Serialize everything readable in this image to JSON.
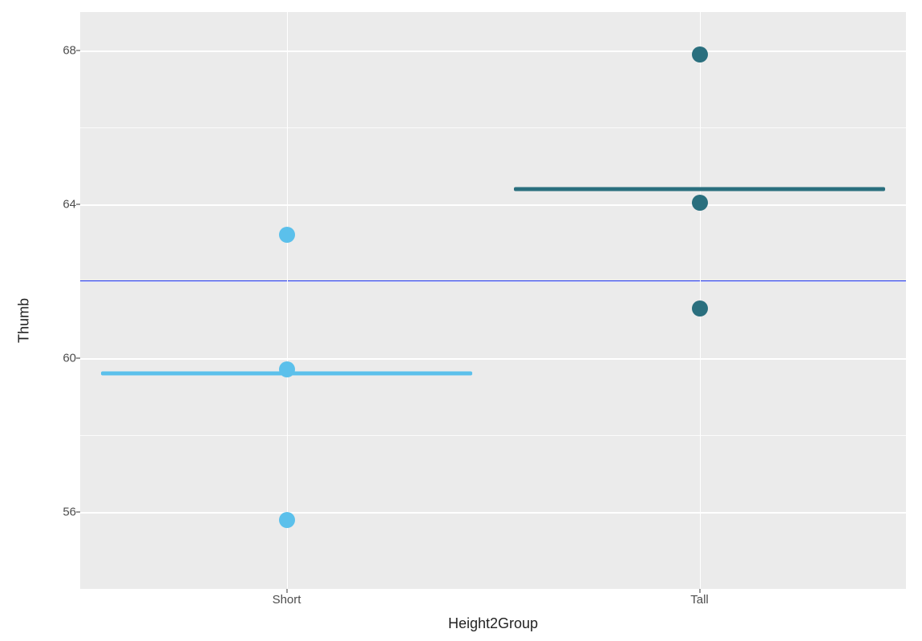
{
  "chart_data": {
    "type": "scatter",
    "xlabel": "Height2Group",
    "ylabel": "Thumb",
    "categories": [
      "Short",
      "Tall"
    ],
    "ylim": [
      54,
      69
    ],
    "y_ticks": [
      56,
      60,
      64,
      68
    ],
    "y_minor_ticks": [
      54,
      58,
      62,
      66
    ],
    "series": [
      {
        "name": "Short",
        "color": "#5bc0eb",
        "values": [
          55.8,
          59.7,
          63.2
        ],
        "mean": 59.6
      },
      {
        "name": "Tall",
        "color": "#2a6f7e",
        "values": [
          61.3,
          64.05,
          67.9
        ],
        "mean": 64.4
      }
    ],
    "overall_mean": 62.0,
    "overall_mean_color": "#2a3ee8"
  }
}
